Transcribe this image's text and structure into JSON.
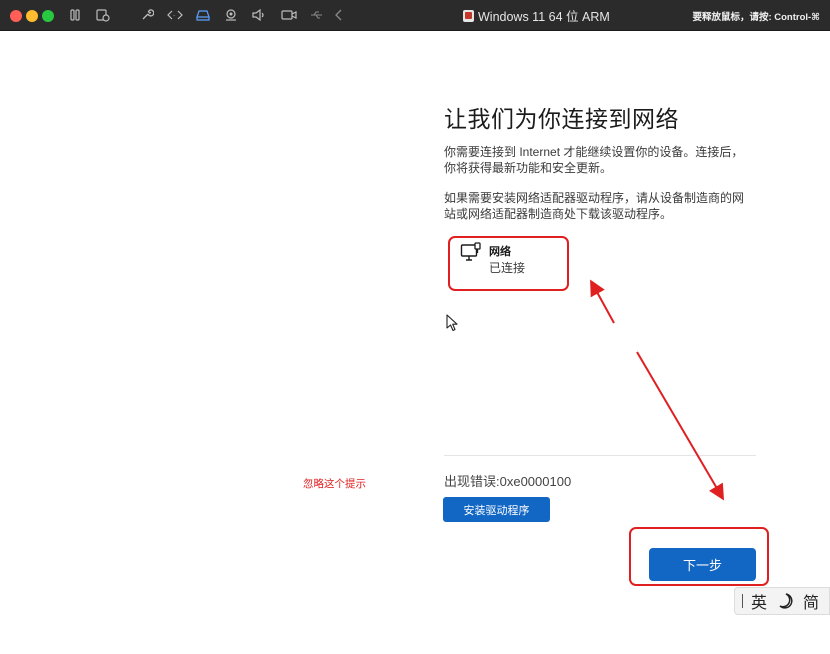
{
  "titlebar": {
    "window_title": "Windows 11 64 位 ARM",
    "release_hint": "要释放鼠标，请按: Control-⌘",
    "icons": [
      "pause-icon",
      "snapshot-icon",
      "settings-wrench-icon",
      "code-icon",
      "drive-icon",
      "camera-icon",
      "sound-icon",
      "video-icon",
      "usb-icon",
      "back-chevron-icon"
    ]
  },
  "oobe": {
    "heading": "让我们为你连接到网络",
    "paragraph1": "你需要连接到 Internet 才能继续设置你的设备。连接后，你将获得最新功能和安全更新。",
    "paragraph2": "如果需要安装网络适配器驱动程序，请从设备制造商的网站或网络适配器制造商处下载该驱动程序。",
    "network": {
      "name": "网络",
      "status": "已连接",
      "icon": "wired-network-icon"
    },
    "error_text": "出现错误:0xe0000100",
    "install_driver_label": "安装驱动程序",
    "next_label": "下一步"
  },
  "annotations": {
    "note": "忽略这个提示",
    "color": "#e02020"
  },
  "ime": {
    "mode": "英",
    "half_width_icon": "moon-icon",
    "script": "简"
  },
  "colors": {
    "accent": "#1266c4",
    "titlebar_bg": "#2b2b2b"
  }
}
